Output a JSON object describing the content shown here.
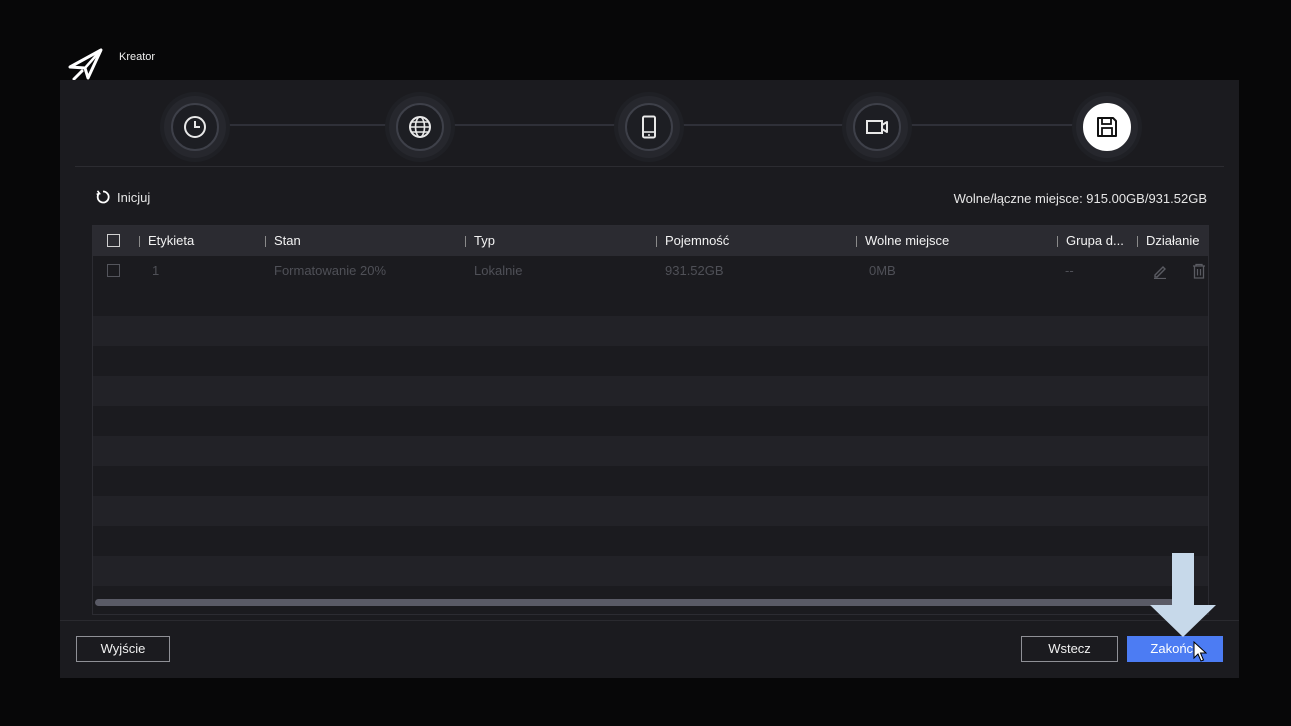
{
  "app": {
    "title": "Kreator"
  },
  "wizard": {
    "steps": [
      {
        "icon": "clock-icon",
        "active": false
      },
      {
        "icon": "globe-icon",
        "active": false
      },
      {
        "icon": "mobile-icon",
        "active": false
      },
      {
        "icon": "camera-icon",
        "active": false
      },
      {
        "icon": "save-icon",
        "active": true
      }
    ]
  },
  "toolbar": {
    "init_label": "Inicjuj",
    "space_info": "Wolne/łączne miejsce: 915.00GB/931.52GB"
  },
  "table": {
    "columns": [
      "Etykieta",
      "Stan",
      "Typ",
      "Pojemność",
      "Wolne miejsce",
      "Grupa d...",
      "Działanie"
    ],
    "rows": [
      {
        "label": "1",
        "status": "Formatowanie 20%",
        "type": "Lokalnie",
        "capacity": "931.52GB",
        "free": "0MB",
        "group": "--"
      }
    ]
  },
  "footer": {
    "exit_label": "Wyjście",
    "back_label": "Wstecz",
    "finish_label": "Zakończ"
  },
  "colors": {
    "accent": "#4c7cf3",
    "arrow": "#c7d9ea"
  }
}
